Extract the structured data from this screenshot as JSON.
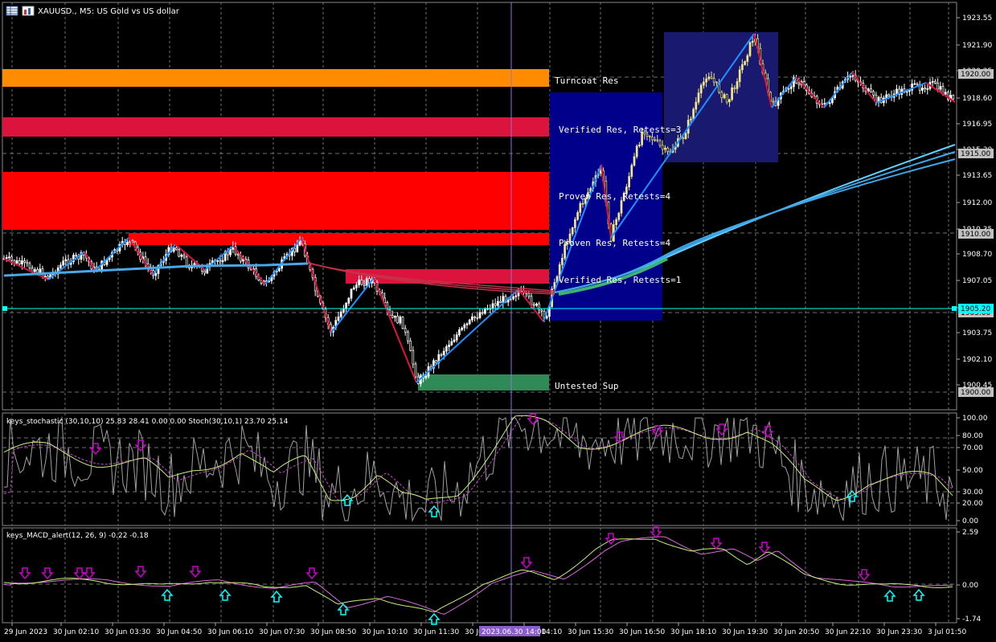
{
  "chart_title": {
    "text": "XAUUSD., M5:  US Gold vs US dollar",
    "menu_icon": "grid-menu-icon",
    "type_icon": "chart-type-icon"
  },
  "zones": [
    {
      "label": "Turncoat Res",
      "color": "#ff8c00"
    },
    {
      "label": "Verified Res, Retests=3",
      "color": "#dc143c"
    },
    {
      "label": "Proven Res, Retests=4",
      "color": "#ff0000"
    },
    {
      "label": "Proven Res, Retests=4",
      "color": "#ff0000"
    },
    {
      "label": "Verified Res, Retests=1",
      "color": "#dc143c"
    },
    {
      "label": "Untested Sup",
      "color": "#2e8b57"
    }
  ],
  "price_axis": {
    "ticks": [
      "1923.55",
      "1921.90",
      "1920.25",
      "1918.60",
      "1916.95",
      "1915.30",
      "1913.65",
      "1912.00",
      "1910.35",
      "1908.70",
      "1907.05",
      "1905.40",
      "1903.75",
      "1902.10",
      "1900.45"
    ],
    "highlight_labels": [
      "1920.00",
      "1915.00",
      "1910.00",
      "1905.00",
      "1900.00"
    ],
    "current_price": "1905.20"
  },
  "stochastic_panel": {
    "title": "keys_stochastic (30,10,10) 25.83 28.41 0.00 0.00 Stoch(30,10,1) 23.70 25.14",
    "ticks": [
      "100.00",
      "80.00",
      "70.00",
      "50.00",
      "30.00",
      "20.00",
      "0.00"
    ]
  },
  "macd_panel": {
    "title": "keys_MACD_alert(12, 26, 9) -0.22 -0.18",
    "ticks": [
      "2.59",
      "0.00",
      "-1.74"
    ]
  },
  "time_axis": {
    "labels": [
      "29 Jun 2023",
      "30 Jun 02:10",
      "30 Jun 03:30",
      "30 Jun 04:50",
      "30 Jun 06:10",
      "30 Jun 07:30",
      "30 Jun 08:50",
      "30 Jun 10:10",
      "30 Jun 11:30",
      "30 Jun 12:50",
      "30 Jun 14:10",
      "30 Jun 15:30",
      "30 Jun 16:50",
      "30 Jun 18:10",
      "30 Jun 19:30",
      "30 Jun 20:50",
      "30 Jun 22:10",
      "30 Jun 23:30",
      "3 Jul 01:50"
    ],
    "crosshair_label": "2023.06.30 14:00"
  },
  "colors": {
    "background": "#000000",
    "grid": "#707070",
    "candle": "#ffffff",
    "bull_candle": "#f0e68c",
    "zigzag_up": "#1e90ff",
    "zigzag_down": "#dc143c",
    "blue_box": "#00008b",
    "navy_box": "#191970",
    "ma": "#1e90ff",
    "current_line": "#00ffff",
    "crosshair": "#9370db",
    "arrow_down": "#cc00cc",
    "arrow_up": "#00ffff"
  }
}
